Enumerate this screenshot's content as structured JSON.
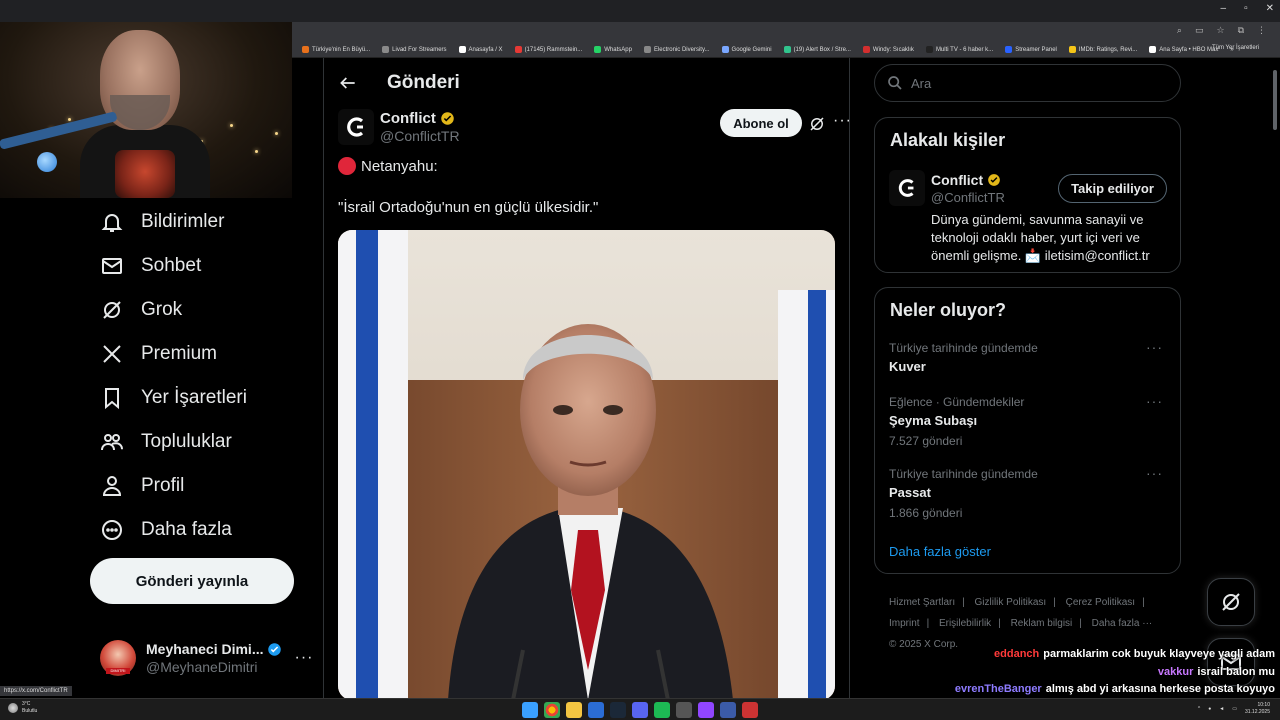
{
  "browser": {
    "bookmarks": [
      {
        "label": "Türkiye'nin En Büyü...",
        "color": "#e8711c"
      },
      {
        "label": "Livad For Streamers",
        "color": "#8a8a8a"
      },
      {
        "label": "Anasayfa / X",
        "color": "#ffffff"
      },
      {
        "label": "(17145) Rammstein...",
        "color": "#e53935"
      },
      {
        "label": "WhatsApp",
        "color": "#25d366"
      },
      {
        "label": "Electronic Diversity...",
        "color": "#888888"
      },
      {
        "label": "Google Gemini",
        "color": "#7aa7ff"
      },
      {
        "label": "(19) Alert Box / Stre...",
        "color": "#31c48d"
      },
      {
        "label": "Windy: Sıcaklık",
        "color": "#d32f2f"
      },
      {
        "label": "Multi TV - 6 haber k...",
        "color": "#222222"
      },
      {
        "label": "Streamer Panel",
        "color": "#2962ff"
      },
      {
        "label": "IMDb: Ratings, Revi...",
        "color": "#f5c518"
      },
      {
        "label": "Ana Sayfa • HBO Max",
        "color": "#ffffff"
      }
    ],
    "more": "»",
    "all_bookmarks": "Tüm Yer İşaretleri",
    "status_url": "https://x.com/ConflictTR"
  },
  "nav": {
    "items": [
      {
        "label": "Bildirimler",
        "icon": "bell-icon"
      },
      {
        "label": "Sohbet",
        "icon": "mail-icon"
      },
      {
        "label": "Grok",
        "icon": "grok-icon"
      },
      {
        "label": "Premium",
        "icon": "x-logo-icon"
      },
      {
        "label": "Yer İşaretleri",
        "icon": "bookmark-icon"
      },
      {
        "label": "Topluluklar",
        "icon": "people-icon"
      },
      {
        "label": "Profil",
        "icon": "person-icon"
      },
      {
        "label": "Daha fazla",
        "icon": "more-circle-icon"
      }
    ],
    "post_button": "Gönderi yayınla",
    "account": {
      "name": "Meyhaneci Dimi...",
      "handle": "@MeyhaneDimitri",
      "avatar_tag": "DIMITRI",
      "more": "···"
    }
  },
  "main": {
    "title": "Gönderi",
    "post": {
      "author": "Conflict",
      "handle": "@ConflictTR",
      "subscribe": "Abone ol",
      "more": "···",
      "line1": "Netanyahu:",
      "line2": "\"İsrail Ortadoğu'nun en güçlü ülkesidir.\""
    }
  },
  "right": {
    "search_placeholder": "Ara",
    "related": {
      "title": "Alakalı kişiler",
      "name": "Conflict",
      "handle": "@ConflictTR",
      "follow": "Takip ediliyor",
      "bio": "Dünya gündemi, savunma sanayii ve teknoloji odaklı haber, yurt içi veri ve önemli gelişme. 📩 iletisim@conflict.tr"
    },
    "trends": {
      "title": "Neler oluyor?",
      "items": [
        {
          "context": "Türkiye tarihinde gündemde",
          "title": "Kuver",
          "count": ""
        },
        {
          "context": "Eğlence · Gündemdekiler",
          "title": "Şeyma Subaşı",
          "count": "7.527 gönderi"
        },
        {
          "context": "Türkiye tarihinde gündemde",
          "title": "Passat",
          "count": "1.866 gönderi"
        }
      ],
      "show_more": "Daha fazla göster",
      "more": "···"
    },
    "footer": {
      "links": [
        "Hizmet Şartları",
        "Gizlilik Politikası",
        "Çerez Politikası",
        "Imprint",
        "Erişilebilirlik",
        "Reklam bilgisi",
        "Daha fazla ···"
      ],
      "copyright": "© 2025 X Corp."
    }
  },
  "chat": [
    {
      "user": "eddanch",
      "message": "parmaklarim cok buyuk klayveye yagli adam",
      "color": "#ff3a3a"
    },
    {
      "user": "vakkur",
      "message": "israil balon mu",
      "color": "#c878ff"
    },
    {
      "user": "evrenTheBanger",
      "message": "almış abd yi arkasına herkese posta koyuyo",
      "color": "#8e7bff"
    },
    {
      "user": "vakkur",
      "message": "",
      "color": "#c878ff"
    }
  ],
  "taskbar": {
    "temp": "3°C",
    "weather": "Bulutlu",
    "time": "10:10",
    "date": "31.12.2025"
  }
}
